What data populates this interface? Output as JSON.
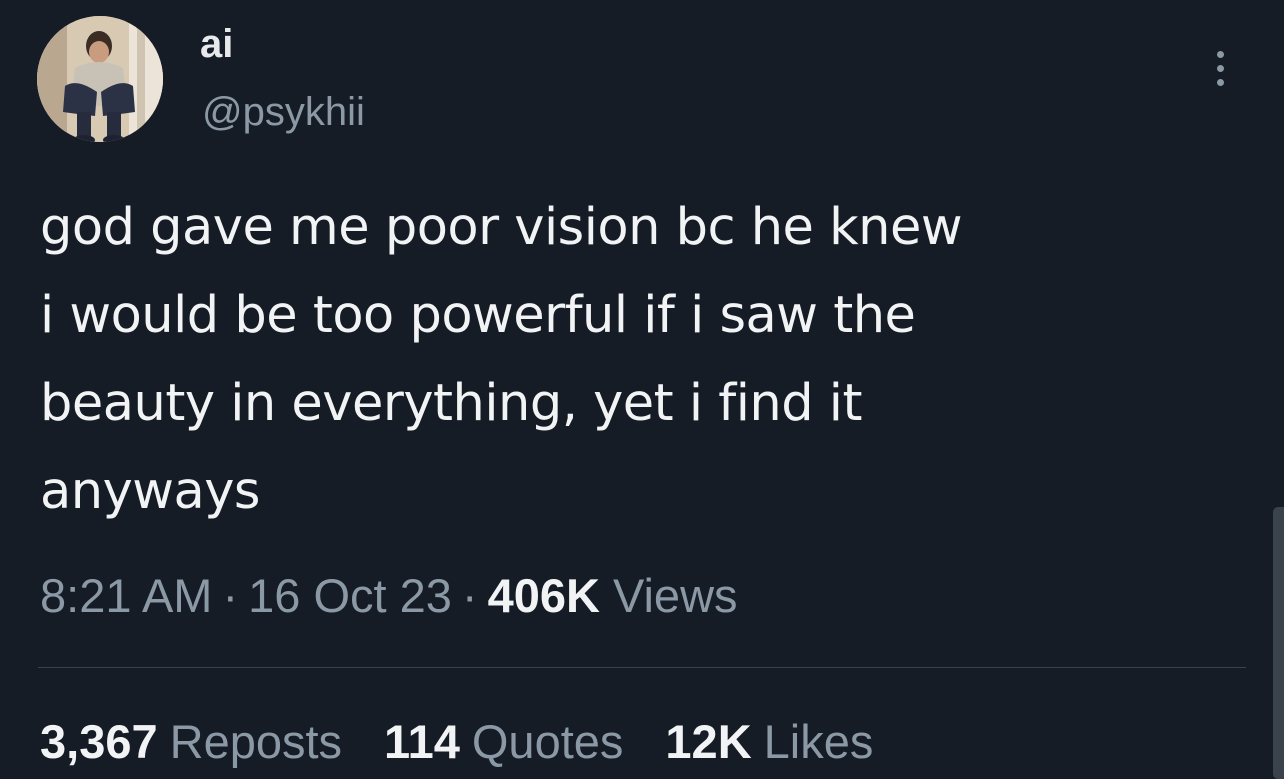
{
  "user": {
    "display_name": "ai",
    "handle": "@psykhii"
  },
  "tweet": {
    "text": "god gave me poor vision bc he knew\ni would be too powerful if i saw the\nbeauty in everything, yet i find it\nanyways",
    "time": "8:21 AM",
    "date": "16 Oct 23",
    "views_count": "406K",
    "views_label": "Views",
    "separator": "·"
  },
  "stats": {
    "reposts_count": "3,367",
    "reposts_label": "Reposts",
    "quotes_count": "114",
    "quotes_label": "Quotes",
    "likes_count": "12K",
    "likes_label": "Likes"
  },
  "icons": {
    "more": "more-horizontal-icon"
  },
  "colors": {
    "background": "#151c26",
    "primary_text": "#e7e9ea",
    "secondary_text": "#8b98a5",
    "divider": "#38444d"
  }
}
